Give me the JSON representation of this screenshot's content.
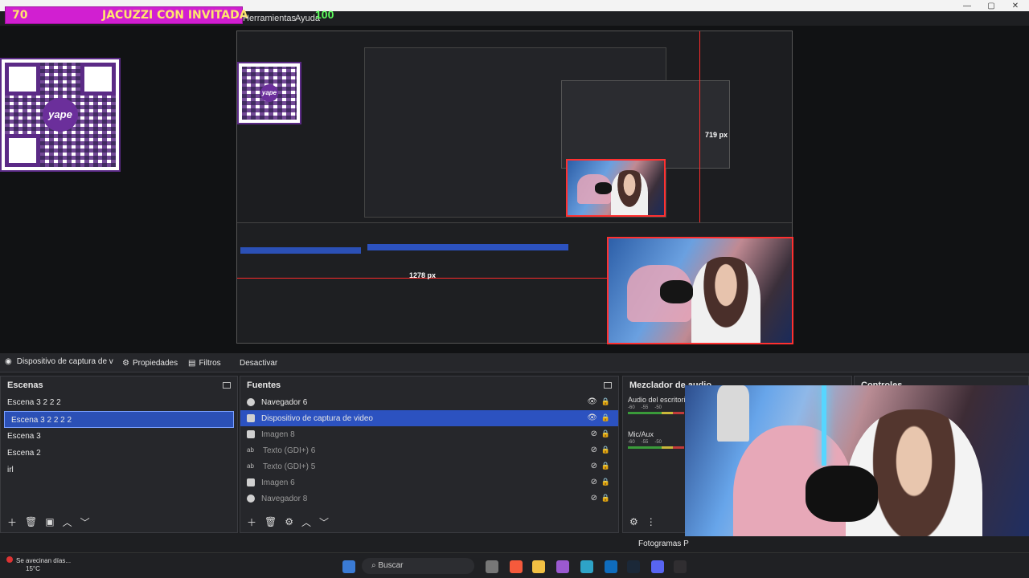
{
  "window": {
    "minimize": "—",
    "maximize": "▢",
    "close": "✕"
  },
  "banner": {
    "number": "70",
    "title": "JACUZZI CON INVITADA",
    "score": "100"
  },
  "menu": {
    "tools": "Herramientas",
    "help": "Ayuda"
  },
  "preview": {
    "measure_h": "1278 px",
    "measure_v": "719 px",
    "inner_measure_v": "719 px"
  },
  "toolbar": {
    "source_name": "Dispositivo de captura de v",
    "properties": "Propiedades",
    "filters": "Filtros",
    "deactivate": "Desactivar"
  },
  "scenes": {
    "title": "Escenas",
    "items": [
      "Escena 3 2 2 2",
      "Escena 3 2 2 2 2",
      "Escena 3",
      "Escena 2",
      "irl"
    ],
    "selected_index": 1
  },
  "sources": {
    "title": "Fuentes",
    "items": [
      {
        "label": "Navegador 6",
        "icon": "browser-icon",
        "visible": true
      },
      {
        "label": "Dispositivo de captura de video",
        "icon": "camera-icon",
        "visible": true
      },
      {
        "label": "Imagen 8",
        "icon": "image-icon",
        "visible": false
      },
      {
        "label": "Texto (GDI+) 6",
        "icon": "text-icon",
        "visible": false
      },
      {
        "label": "Texto (GDI+) 5",
        "icon": "text-icon",
        "visible": false
      },
      {
        "label": "Imagen 6",
        "icon": "image-icon",
        "visible": false
      },
      {
        "label": "Navegador 8",
        "icon": "browser-icon",
        "visible": false
      }
    ],
    "selected_index": 1
  },
  "mixer": {
    "title": "Mezclador de audio",
    "desktop": "Audio del escritorio",
    "mic": "Mic/Aux",
    "scale": [
      "-60",
      "-55",
      "-50"
    ]
  },
  "controls": {
    "title": "Controles"
  },
  "status": {
    "fps": "Fotogramas P"
  },
  "taskbar": {
    "search": "Buscar",
    "weather_text": "Se avecinan días...",
    "weather_temp": "15°C"
  },
  "colors": {
    "accent": "#2c52c0",
    "banner": "#d11fd1",
    "banner_text": "#ffe66d",
    "score_text": "#5dff5d",
    "guide_red": "#ff2b2b"
  }
}
